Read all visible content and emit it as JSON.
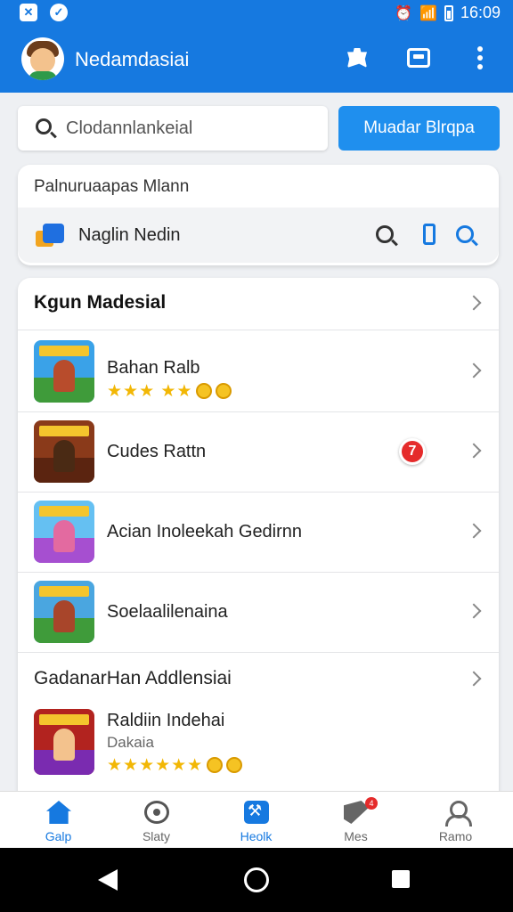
{
  "status_bar": {
    "time": "16:09"
  },
  "app_bar": {
    "title": "Nedamdasiai"
  },
  "search": {
    "placeholder": "Clodannlankeial",
    "button_label": "Muadar Blrqpa"
  },
  "card_top": {
    "heading": "Palnuruaapas Mlann",
    "quick_item_label": "Naglin Nedin"
  },
  "section_1": {
    "title": "Kgun Madesial",
    "items": [
      {
        "title": "Bahan Ralb",
        "rating_text": "★★★ ★★",
        "has_stars": true,
        "sky": "#3aa2e8",
        "char_color": "#b84c2c"
      },
      {
        "title": "Cudes Rattn",
        "badge": "7",
        "sky": "#8a3a1a",
        "char_color": "#4a2a14"
      },
      {
        "title": "Acian Inoleekah Gedirnn",
        "sky": "#65c0f2",
        "char_color": "#e36aa0"
      },
      {
        "title": "Soelaalilenaina",
        "sky": "#4aa6e0",
        "char_color": "#a8452a"
      }
    ]
  },
  "section_2": {
    "title": "GadanarHan Addlensiai",
    "items": [
      {
        "title": "Raldiin Indehai",
        "subtitle": "Dakaia",
        "rating_text": "★★★★★★",
        "sky": "#b2231f",
        "char_color": "#6a3a1e"
      }
    ]
  },
  "bottom_nav": [
    {
      "label": "Galp",
      "active": true
    },
    {
      "label": "Slaty",
      "active": false
    },
    {
      "label": "Heolk",
      "active": true
    },
    {
      "label": "Mes",
      "active": false,
      "badge": "4"
    },
    {
      "label": "Ramo",
      "active": false
    }
  ],
  "colors": {
    "primary": "#1679e0",
    "button": "#1f8fee",
    "star": "#f2b705",
    "badge": "#e52b2b"
  }
}
